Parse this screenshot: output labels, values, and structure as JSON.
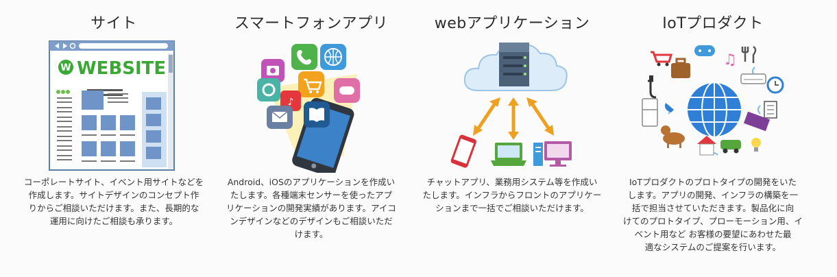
{
  "services": [
    {
      "title": "サイト",
      "illustration": "website-mockup",
      "logo_text": "WEBSITE",
      "desc": [
        "コーポレートサイト、イベント用サイトなどを",
        "作成します。サイトデザインのコンセプト作",
        "りからご相談いただけます。また、長期的な",
        "運用に向けたご相談も承ります。"
      ]
    },
    {
      "title": "スマートフォンアプリ",
      "illustration": "smartphone-with-app-icons",
      "desc": [
        "Android、iOSのアプリケーションを作成い",
        "たします。各種端末センサーを使ったアプ",
        "リケーションの開発実績があります。アイコ",
        "ンデザインなどのデザインもご相談いただ",
        "けます。"
      ]
    },
    {
      "title": "webアプリケーション",
      "illustration": "cloud-server-devices",
      "desc": [
        "チャットアプリ、業務用システム等を作成い",
        "たします。インフラからフロントのアプリケー",
        "ションまで一括でご相談いただけます。"
      ]
    },
    {
      "title": "IoTプロダクト",
      "illustration": "globe-connected-devices",
      "desc": [
        "IoTプロダクトのプロトタイプの開発をいた",
        "します。アプリの開発、インフラの構築を一",
        "括で担当させていただきます。製品化に向",
        "けてのプロトタイプ、プローモーション用、イ",
        "ベント用など お客様の要望にあわせた最",
        "適なシステムのご提案を行います。"
      ]
    }
  ],
  "colors": {
    "brand_green": "#39a934",
    "web_blue": "#2f7fd6",
    "phone_dark": "#2f3640",
    "cloud": "#dcecf8",
    "arrow_orange": "#f0a020",
    "server_navy": "#4c6177"
  }
}
